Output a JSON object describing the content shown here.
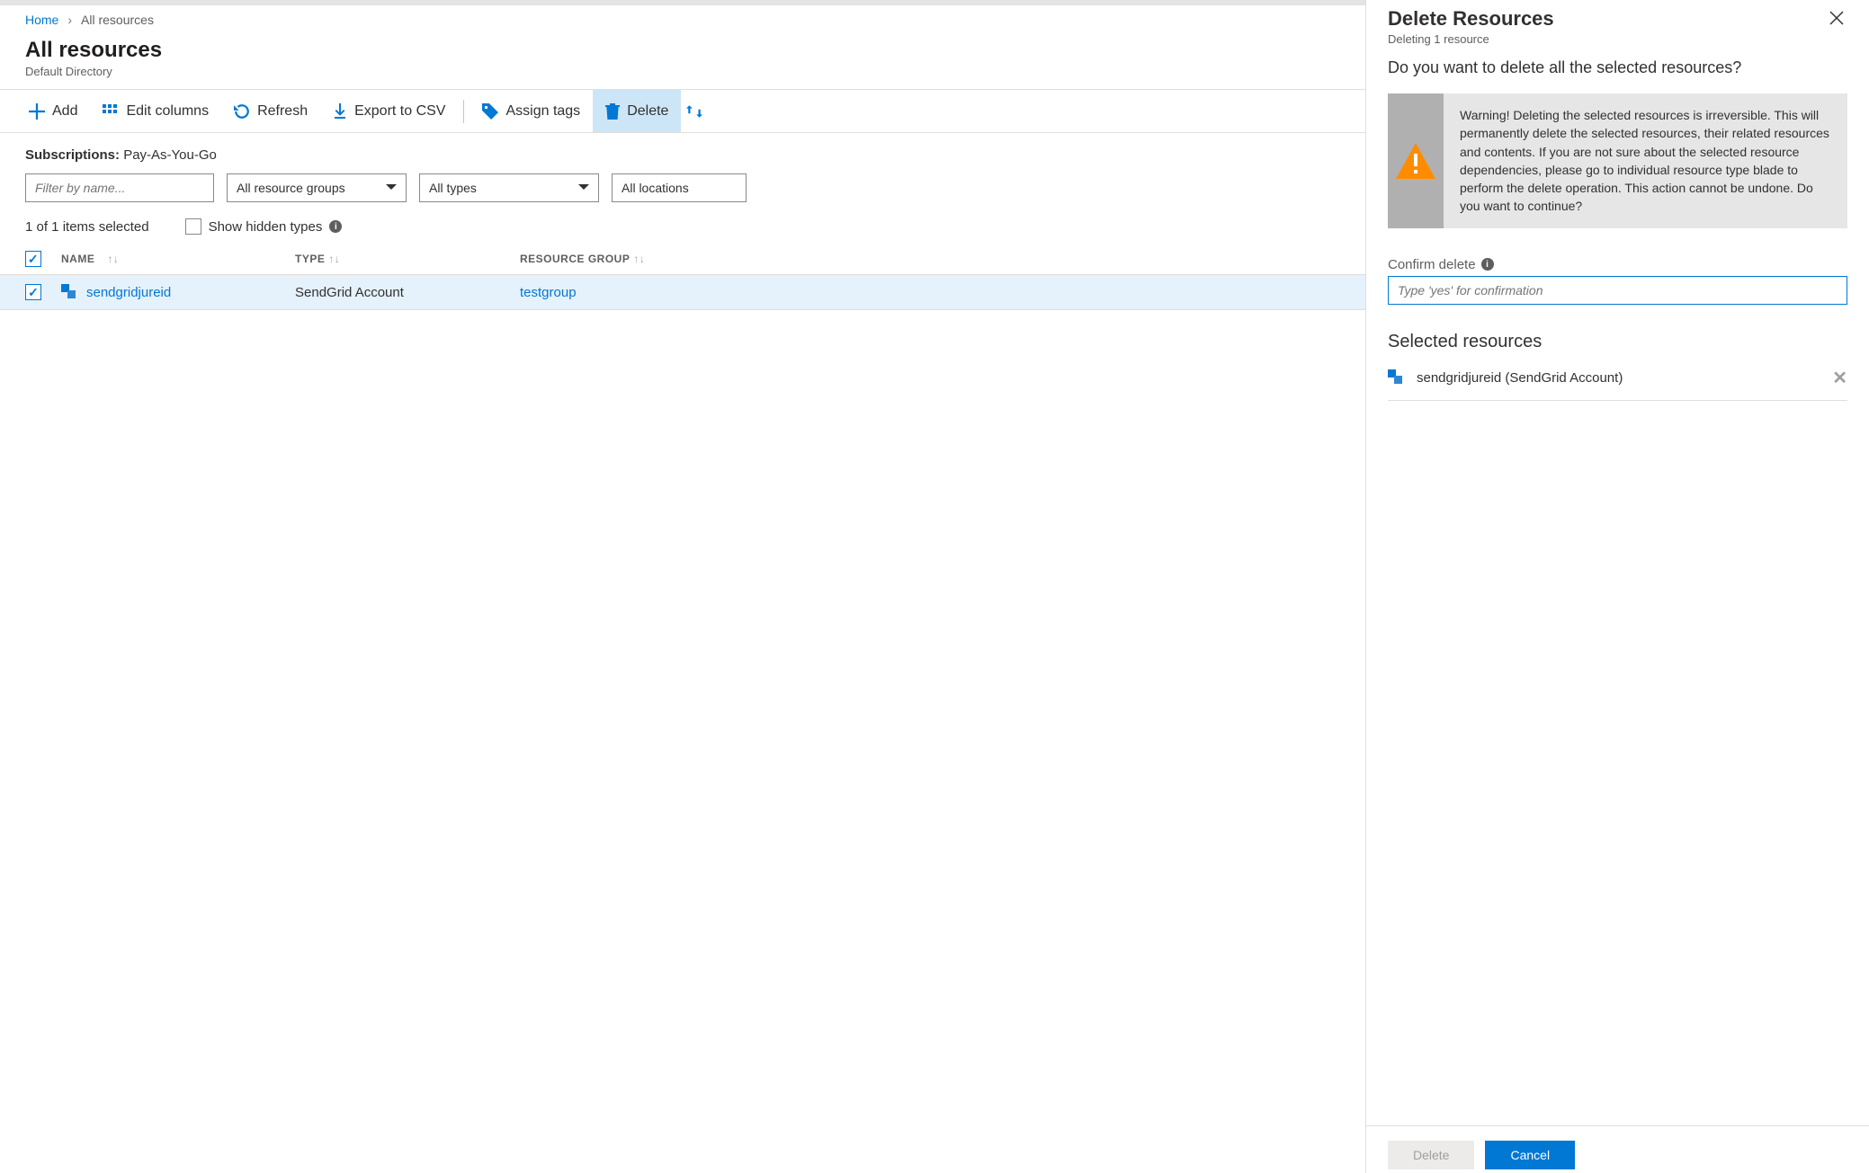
{
  "breadcrumb": {
    "home": "Home",
    "current": "All resources"
  },
  "header": {
    "title": "All resources",
    "subtitle": "Default Directory"
  },
  "toolbar": {
    "add": "Add",
    "edit_columns": "Edit columns",
    "refresh": "Refresh",
    "export_csv": "Export to CSV",
    "assign_tags": "Assign tags",
    "delete": "Delete"
  },
  "subscriptions": {
    "label": "Subscriptions:",
    "value": "Pay-As-You-Go"
  },
  "filters": {
    "name_placeholder": "Filter by name...",
    "resource_groups": "All resource groups",
    "types": "All types",
    "locations": "All locations"
  },
  "status": {
    "selection": "1 of 1 items selected",
    "show_hidden": "Show hidden types"
  },
  "table": {
    "headers": {
      "name": "NAME",
      "type": "TYPE",
      "rg": "RESOURCE GROUP"
    },
    "rows": [
      {
        "checked": true,
        "name": "sendgridjureid",
        "type": "SendGrid Account",
        "rg": "testgroup"
      }
    ]
  },
  "side": {
    "title": "Delete Resources",
    "subtitle": "Deleting 1 resource",
    "question": "Do you want to delete all the selected resources?",
    "warning": "Warning! Deleting the selected resources is irreversible. This will permanently delete the selected resources, their related resources and contents. If you are not sure about the selected resource dependencies, please go to individual resource type blade to perform the delete operation. This action cannot be undone. Do you want to continue?",
    "confirm_label": "Confirm delete",
    "confirm_placeholder": "Type 'yes' for confirmation",
    "selected_heading": "Selected resources",
    "selected": [
      {
        "name": "sendgridjureid",
        "type": "SendGrid Account"
      }
    ],
    "buttons": {
      "delete": "Delete",
      "cancel": "Cancel"
    }
  }
}
